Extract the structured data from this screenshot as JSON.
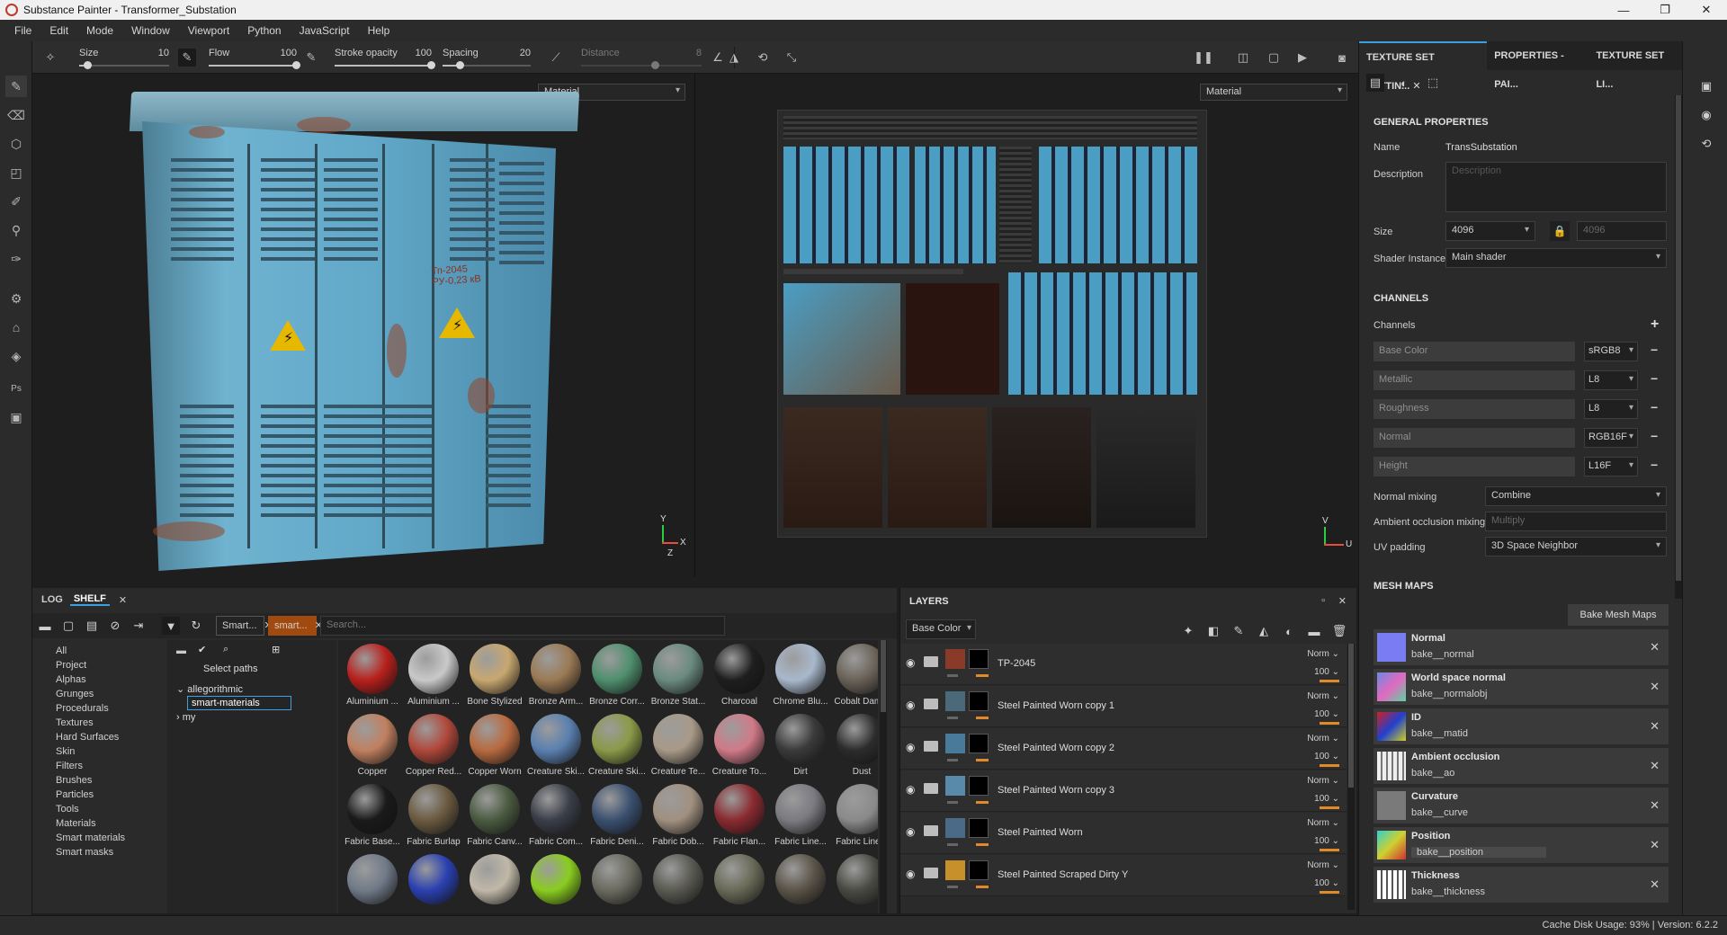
{
  "window": {
    "title": "Substance Painter - Transformer_Substation",
    "controls": [
      "—",
      "❐",
      "✕"
    ]
  },
  "menu": [
    "File",
    "Edit",
    "Mode",
    "Window",
    "Viewport",
    "Python",
    "JavaScript",
    "Help"
  ],
  "toolbar": {
    "size_label": "Size",
    "size_value": "10",
    "size_level": 0.1,
    "flow_label": "Flow",
    "flow_value": "100",
    "flow_level": 1.0,
    "stroke_label": "Stroke opacity",
    "stroke_value": "100",
    "stroke_level": 1.0,
    "spacing_label": "Spacing",
    "spacing_value": "20",
    "spacing_level": 0.2,
    "distance_label": "Distance",
    "distance_value": "8"
  },
  "viewport3d": {
    "channel": "Material",
    "axis_y": "Y",
    "axis_x": "X",
    "axis_z": "Z"
  },
  "viewport2d": {
    "channel": "Material",
    "axis_v": "V",
    "axis_u": "U"
  },
  "cabinet_text": "Тп-2045 РУ-0,23 кВ",
  "right_panel": {
    "tabs": [
      "TEXTURE SET SETTIN...",
      "PROPERTIES - PAI...",
      "TEXTURE SET LI..."
    ],
    "general_title": "GENERAL PROPERTIES",
    "name_label": "Name",
    "name_value": "TransSubstation",
    "description_label": "Description",
    "description_placeholder": "Description",
    "size_label": "Size",
    "size_value": "4096",
    "size_locked_value": "4096",
    "shader_label": "Shader Instance",
    "shader_value": "Main shader",
    "channels_title": "CHANNELS",
    "channels_label": "Channels",
    "channels": [
      {
        "name": "Base Color",
        "format": "sRGB8"
      },
      {
        "name": "Metallic",
        "format": "L8"
      },
      {
        "name": "Roughness",
        "format": "L8"
      },
      {
        "name": "Normal",
        "format": "RGB16F"
      },
      {
        "name": "Height",
        "format": "L16F"
      }
    ],
    "normal_mixing_label": "Normal mixing",
    "normal_mixing_value": "Combine",
    "ao_mixing_label": "Ambient occlusion mixing",
    "ao_mixing_value": "Multiply",
    "uv_padding_label": "UV padding",
    "uv_padding_value": "3D Space Neighbor",
    "mesh_maps_title": "MESH MAPS",
    "bake_button": "Bake Mesh Maps",
    "mesh_maps": [
      {
        "title": "Normal",
        "file": "bake__normal"
      },
      {
        "title": "World space normal",
        "file": "bake__normalobj"
      },
      {
        "title": "ID",
        "file": "bake__matid"
      },
      {
        "title": "Ambient occlusion",
        "file": "bake__ao"
      },
      {
        "title": "Curvature",
        "file": "bake__curve"
      },
      {
        "title": "Position",
        "file": "bake__position"
      },
      {
        "title": "Thickness",
        "file": "bake__thickness"
      }
    ]
  },
  "shelf": {
    "tabs": [
      "LOG",
      "SHELF"
    ],
    "filter_chips": [
      "Smart...",
      "smart..."
    ],
    "search_placeholder": "Search...",
    "categories": [
      "All",
      "Project",
      "Alphas",
      "Grunges",
      "Procedurals",
      "Textures",
      "Hard Surfaces",
      "Skin",
      "Filters",
      "Brushes",
      "Particles",
      "Tools",
      "Materials",
      "Smart materials",
      "Smart masks"
    ],
    "select_paths": "Select paths",
    "tree": [
      "allegorithmic",
      "smart-materials",
      "my"
    ],
    "materials": [
      {
        "name": "Aluminium ...",
        "color": "#b8201c"
      },
      {
        "name": "Aluminium ...",
        "color": "#c9c9c9"
      },
      {
        "name": "Bone Stylized",
        "color": "#c8a770"
      },
      {
        "name": "Bronze Arm...",
        "color": "#9b7a55"
      },
      {
        "name": "Bronze Corr...",
        "color": "#4f8f6e"
      },
      {
        "name": "Bronze Stat...",
        "color": "#6a8a80"
      },
      {
        "name": "Charcoal",
        "color": "#1e1e1e"
      },
      {
        "name": "Chrome Blu...",
        "color": "#a8b8cc"
      },
      {
        "name": "Cobalt Dam...",
        "color": "#6a6258"
      },
      {
        "name": "Copper",
        "color": "#c08060"
      },
      {
        "name": "Copper Red...",
        "color": "#b0483a"
      },
      {
        "name": "Copper Worn",
        "color": "#b86a40"
      },
      {
        "name": "Creature Ski...",
        "color": "#5a80b0"
      },
      {
        "name": "Creature Ski...",
        "color": "#8a9a48"
      },
      {
        "name": "Creature Te...",
        "color": "#a89a88"
      },
      {
        "name": "Creature To...",
        "color": "#d07a88"
      },
      {
        "name": "Dirt",
        "color": "#3a3a3a"
      },
      {
        "name": "Dust",
        "color": "#2c2c2c"
      },
      {
        "name": "Fabric Base...",
        "color": "#1a1a1a"
      },
      {
        "name": "Fabric Burlap",
        "color": "#6a5a40"
      },
      {
        "name": "Fabric Canv...",
        "color": "#4a5a40"
      },
      {
        "name": "Fabric Com...",
        "color": "#3a3e48"
      },
      {
        "name": "Fabric Deni...",
        "color": "#3a5070"
      },
      {
        "name": "Fabric Dob...",
        "color": "#a09080"
      },
      {
        "name": "Fabric Flan...",
        "color": "#8a2a30"
      },
      {
        "name": "Fabric Line...",
        "color": "#7a7a80"
      },
      {
        "name": "Fabric Line...",
        "color": "#8a8a8a"
      },
      {
        "name": "",
        "color": "#707a88"
      },
      {
        "name": "",
        "color": "#2a40b0"
      },
      {
        "name": "",
        "color": "#c0b8a8"
      },
      {
        "name": "",
        "color": "#8acc20"
      },
      {
        "name": "",
        "color": "#6a6a60"
      },
      {
        "name": "",
        "color": "#5a5a52"
      },
      {
        "name": "",
        "color": "#6a6a58"
      },
      {
        "name": "",
        "color": "#5a5448"
      },
      {
        "name": "",
        "color": "#4a4a44"
      }
    ]
  },
  "layers": {
    "title": "LAYERS",
    "channel": "Base Color",
    "items": [
      {
        "name": "TP-2045",
        "blend": "Norm",
        "opacity": "100",
        "thumb": "#8a3a28"
      },
      {
        "name": "Steel Painted Worn copy 1",
        "blend": "Norm",
        "opacity": "100",
        "thumb": "#4a6a7a"
      },
      {
        "name": "Steel Painted Worn copy 2",
        "blend": "Norm",
        "opacity": "100",
        "thumb": "#4a7a9a"
      },
      {
        "name": "Steel Painted Worn copy 3",
        "blend": "Norm",
        "opacity": "100",
        "thumb": "#5a8aaa"
      },
      {
        "name": "Steel Painted Worn",
        "blend": "Norm",
        "opacity": "100",
        "thumb": "#4a6a88"
      },
      {
        "name": "Steel Painted Scraped Dirty Y",
        "blend": "Norm",
        "opacity": "100",
        "thumb": "#c8902a"
      }
    ]
  },
  "status": "Cache Disk Usage:   93% | Version: 6.2.2"
}
